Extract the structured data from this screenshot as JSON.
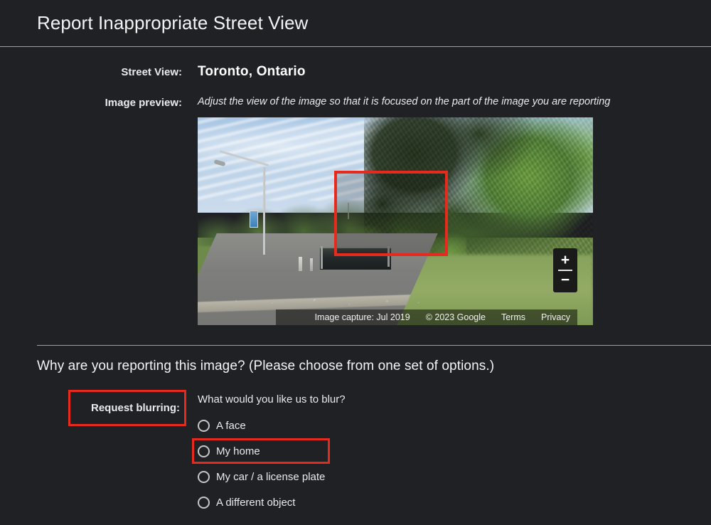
{
  "header": {
    "title": "Report Inappropriate Street View"
  },
  "form": {
    "street_view_label": "Street View:",
    "street_view_value": "Toronto, Ontario",
    "image_preview_label": "Image preview:",
    "image_preview_hint": "Adjust the view of the image so that it is focused on the part of the image you are reporting"
  },
  "pano": {
    "zoom_in": "+",
    "zoom_out": "−",
    "attribution": {
      "capture": "Image capture: Jul 2019",
      "copyright": "© 2023 Google",
      "terms": "Terms",
      "privacy": "Privacy"
    }
  },
  "question": {
    "heading": "Why are you reporting this image?  (Please choose from one set of options.)",
    "blur_label": "Request blurring:",
    "blur_question": "What would you like us to blur?",
    "options": [
      {
        "label": "A face",
        "selected": false,
        "highlighted": false
      },
      {
        "label": "My home",
        "selected": false,
        "highlighted": true
      },
      {
        "label": "My car / a license plate",
        "selected": false,
        "highlighted": false
      },
      {
        "label": "A different object",
        "selected": false,
        "highlighted": false
      }
    ]
  },
  "colors": {
    "background": "#202124",
    "text": "#e8eaed",
    "divider": "#9aa0a6",
    "annotation_red": "#e62b1e"
  }
}
